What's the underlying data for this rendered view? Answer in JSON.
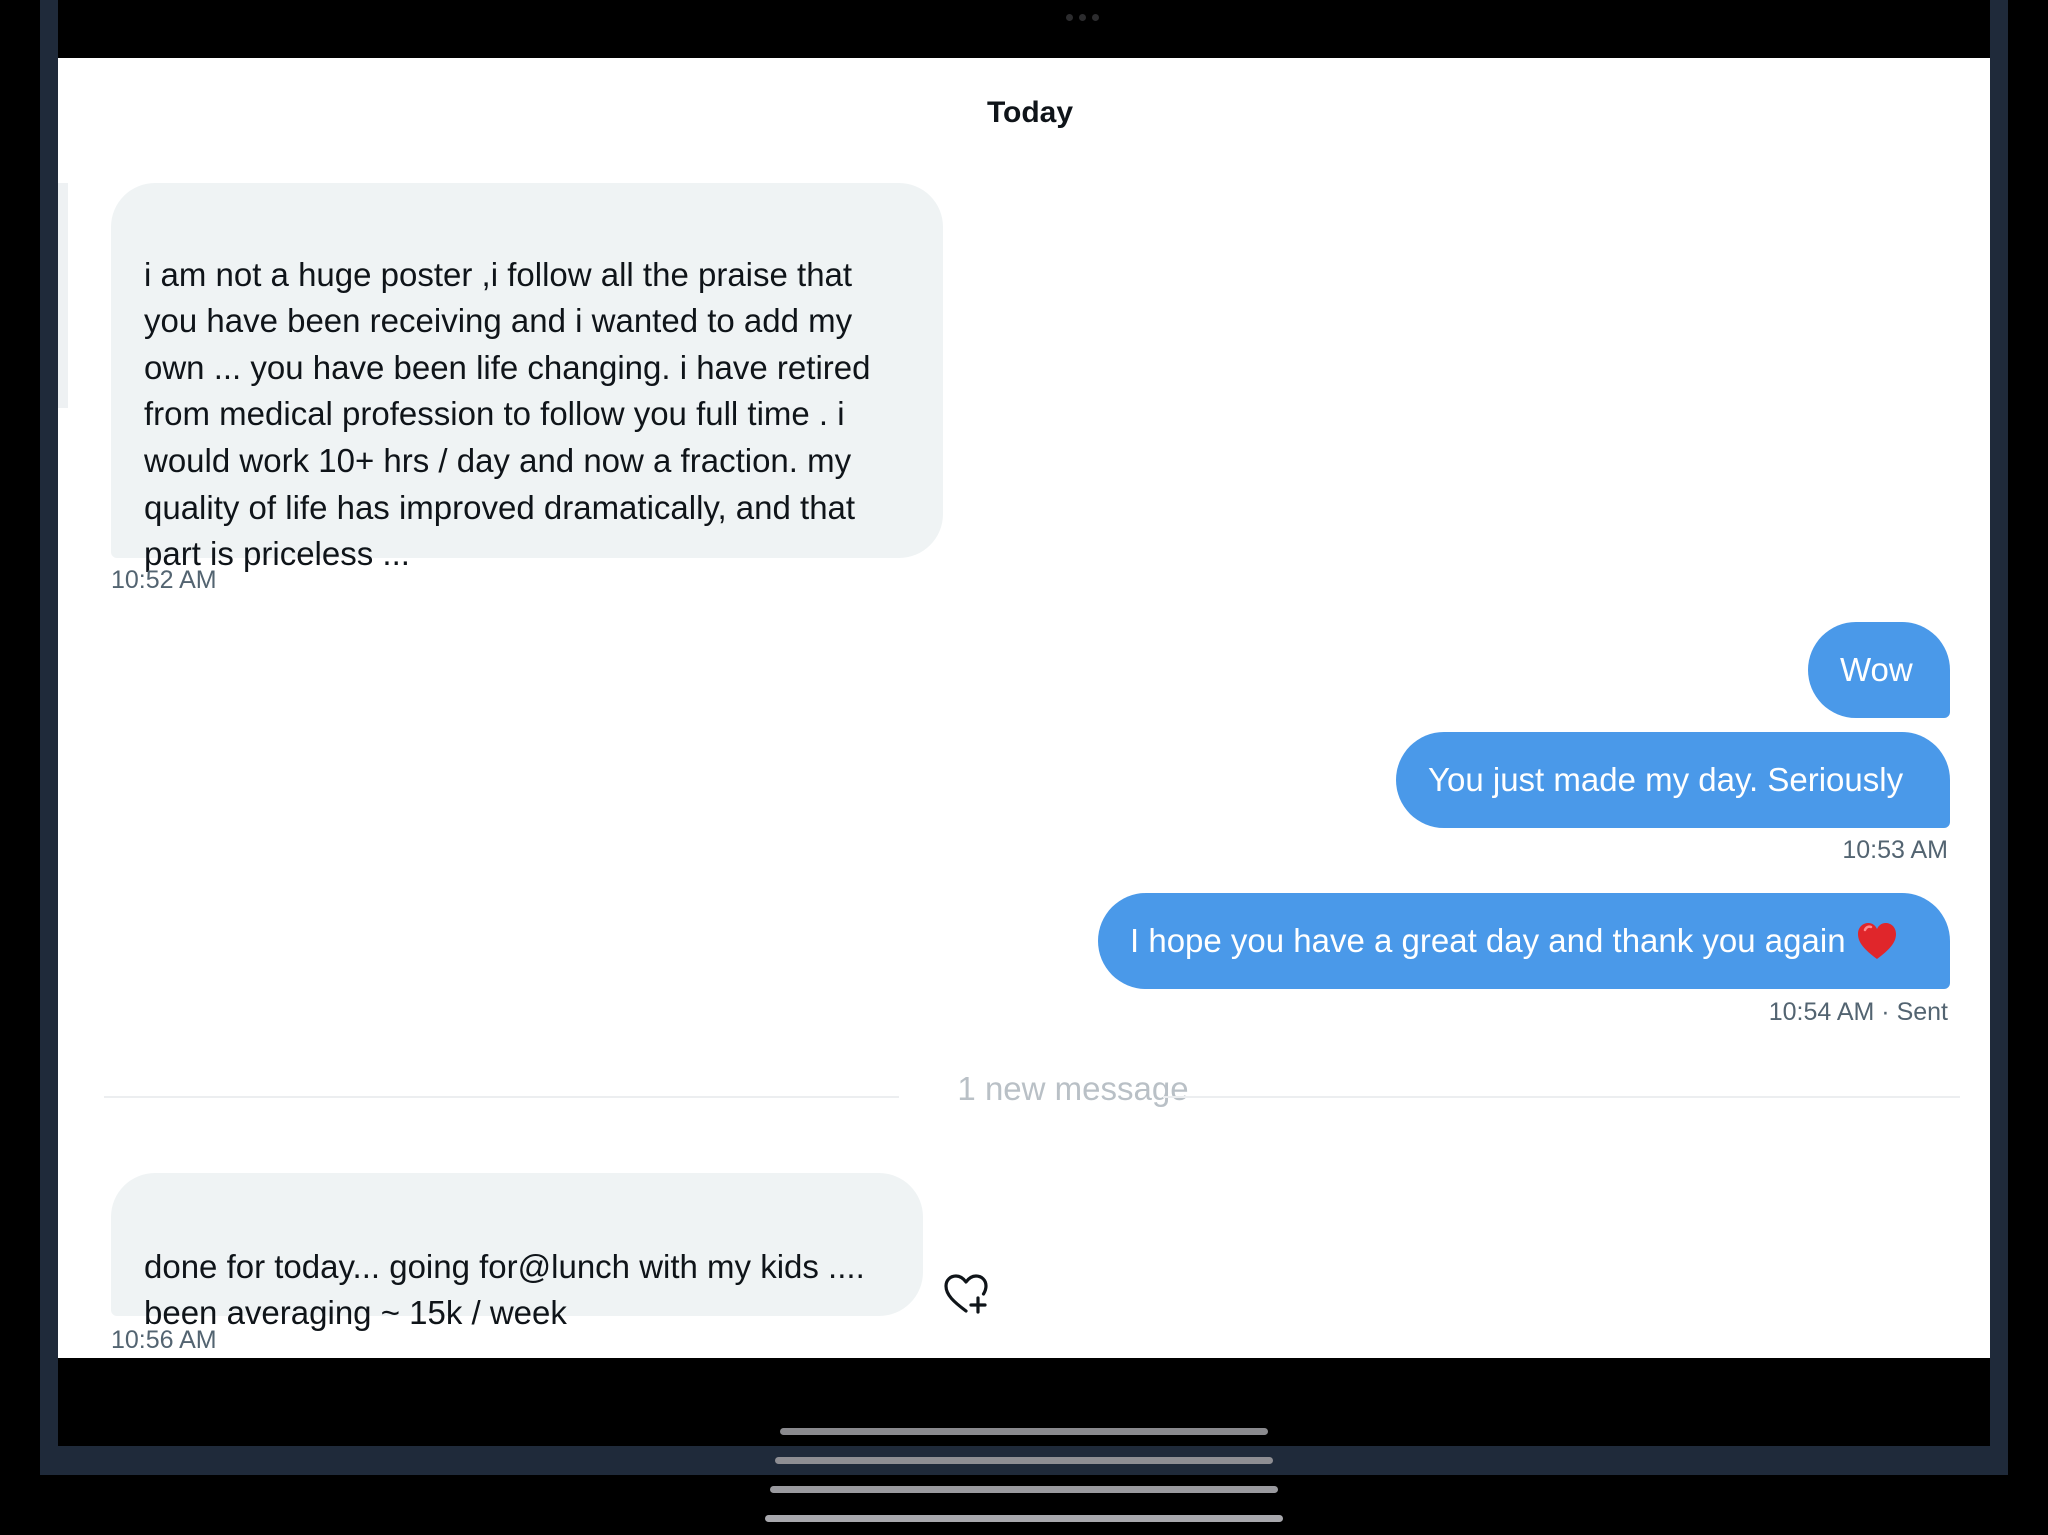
{
  "chat": {
    "day_header": "Today",
    "messages": [
      {
        "direction": "incoming",
        "text": "i am not a huge poster ,i follow all the praise that\nyou have been receiving and  i wanted to add my\nown ...  you have been life changing.  i have retired\nfrom medical profession to follow you full time . i\nwould work 10+ hrs / day and now a fraction. my\nquality of life has improved dramatically, and that\npart is priceless ...",
        "time": "10:52 AM"
      },
      {
        "direction": "outgoing",
        "text": "Wow"
      },
      {
        "direction": "outgoing",
        "text": "You just made my day. Seriously",
        "time": "10:53 AM"
      },
      {
        "direction": "outgoing",
        "text": "I hope you have a great day and thank you again",
        "emoji": "red-heart",
        "time": "10:54 AM",
        "status": "· Sent"
      },
      {
        "direction": "incoming",
        "text": "done for today...  going for@lunch with my kids ....\nbeen averaging ~ 15k / week",
        "time": "10:56 AM"
      }
    ],
    "new_message_divider": "1 new message",
    "reaction_icon": "heart-plus-icon"
  },
  "colors": {
    "outgoing_bubble": "#4a99e9",
    "incoming_bubble": "#eff3f4",
    "timestamp": "#536471",
    "bezel": "#1f2a3a",
    "heart_emoji": "#e0262b"
  }
}
